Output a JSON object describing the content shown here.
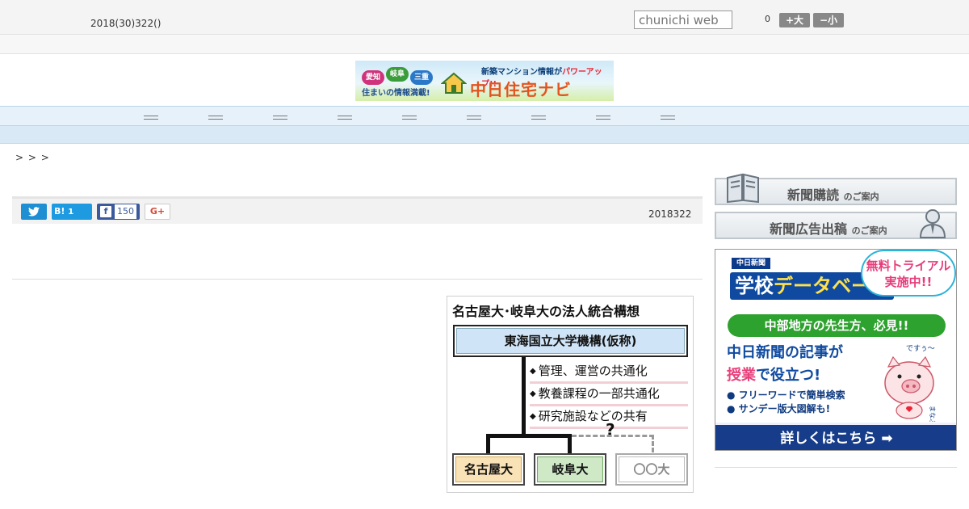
{
  "header": {
    "date": "2018(30)322()",
    "search_placeholder": "chunichi web",
    "count": "0",
    "font_size_up_label": "+大",
    "font_size_down_label": "−小"
  },
  "banner": {
    "prefs": [
      "愛知",
      "岐阜",
      "三重"
    ],
    "tagline": "住まいの情報満載!",
    "sub_text": "新築マンション情報が",
    "sub_emphasis": "パワーアップ!!",
    "title": "中日住宅ナビ"
  },
  "breadcrumb": ">  >  >",
  "share": {
    "hatena_label": "B!",
    "hatena_count": "1",
    "facebook_label": "f",
    "facebook_count": "150",
    "gplus_label": "G+"
  },
  "article": {
    "date": "2018322"
  },
  "figure": {
    "title": "名古屋大･岐阜大の法人統合構想",
    "organization": "東海国立大学機構(仮称)",
    "bullets": [
      "管理、運営の共通化",
      "教養課程の一部共通化",
      "研究施設などの共有"
    ],
    "question_mark": "?",
    "members": [
      "名古屋大",
      "岐阜大",
      "〇〇大"
    ]
  },
  "sidebar": {
    "subscribe_main": "新聞購読",
    "subscribe_suffix": "のご案内",
    "advertise_main": "新聞広告出稿",
    "advertise_suffix": "のご案内"
  },
  "ad": {
    "logo": "中日新聞",
    "title_main": "学校",
    "title_accent": "データベース",
    "badge_line1": "無料トライアル",
    "badge_line2": "実施中!!",
    "subtitle": "中部地方の先生方、必見!!",
    "body_line1": "中日新聞の記事が",
    "body_pink": "授業",
    "body_line2_rest": "で役立つ!",
    "list": [
      "● フリーワードで簡単検索",
      "● サンデー版大図解も!"
    ],
    "pig_speech": "ですぅ〜",
    "pig_name": "まなぶぅ",
    "cta": "詳しくはこちら ➡"
  }
}
